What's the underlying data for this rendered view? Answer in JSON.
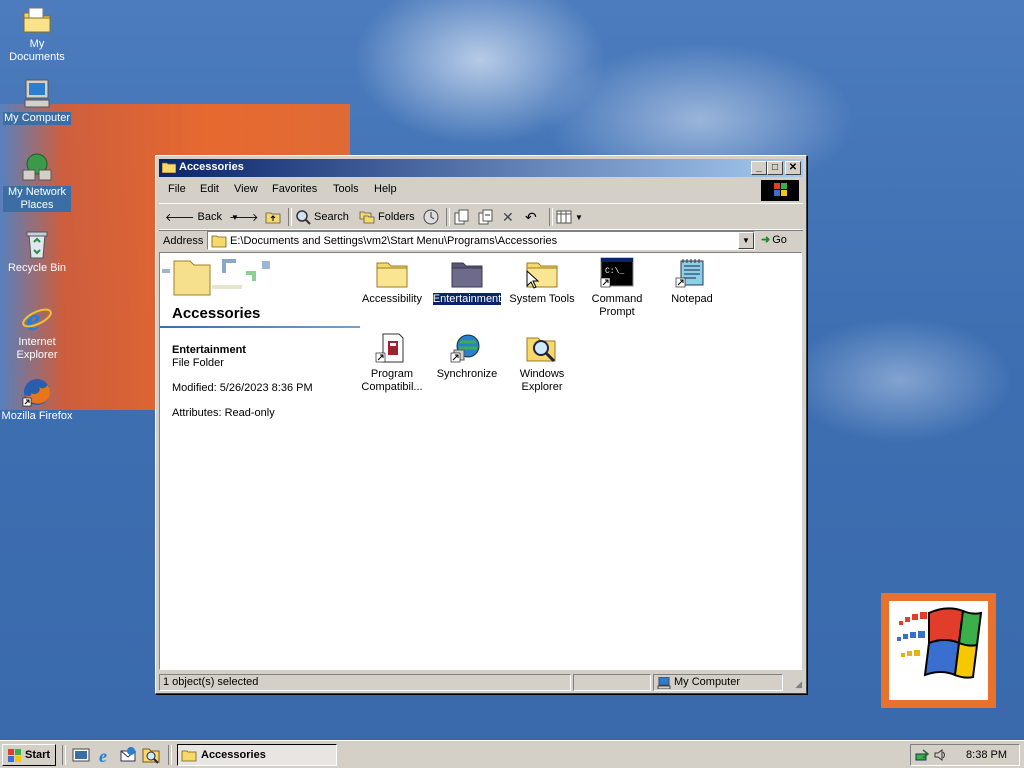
{
  "desktop": {
    "icons": [
      {
        "label": "My Documents"
      },
      {
        "label": "My Computer"
      },
      {
        "label": "My Network Places"
      },
      {
        "label": "Recycle Bin"
      },
      {
        "label": "Internet Explorer"
      },
      {
        "label": "Mozilla Firefox"
      }
    ]
  },
  "window": {
    "title": "Accessories",
    "menu": [
      "File",
      "Edit",
      "View",
      "Favorites",
      "Tools",
      "Help"
    ],
    "toolbar": {
      "back_label": "Back",
      "search_label": "Search",
      "folders_label": "Folders"
    },
    "address": {
      "label": "Address",
      "value": "E:\\Documents and Settings\\vm2\\Start Menu\\Programs\\Accessories",
      "go_label": "Go"
    },
    "left_pane": {
      "title": "Accessories",
      "selected_name": "Entertainment",
      "selected_type": "File Folder",
      "modified": "Modified: 5/26/2023 8:36 PM",
      "attributes": "Attributes: Read-only"
    },
    "items": [
      {
        "label": "Accessibility",
        "icon": "folder-icon"
      },
      {
        "label": "Entertainment",
        "icon": "folder-icon",
        "selected": true
      },
      {
        "label": "System Tools",
        "icon": "folder-icon"
      },
      {
        "label": "Command Prompt",
        "icon": "command-prompt-icon"
      },
      {
        "label": "Notepad",
        "icon": "notepad-icon"
      },
      {
        "label": "Program Compatibil...",
        "icon": "program-compatibility-icon"
      },
      {
        "label": "Synchronize",
        "icon": "synchronize-icon"
      },
      {
        "label": "Windows Explorer",
        "icon": "windows-explorer-icon"
      }
    ],
    "status": {
      "left": "1 object(s) selected",
      "right": "My Computer"
    }
  },
  "taskbar": {
    "start_label": "Start",
    "task_label": "Accessories",
    "clock": "8:38 PM"
  },
  "colors": {
    "titlebar": "#0a246a",
    "desktop": "#3a6ea5",
    "selection": "#0a246a"
  }
}
